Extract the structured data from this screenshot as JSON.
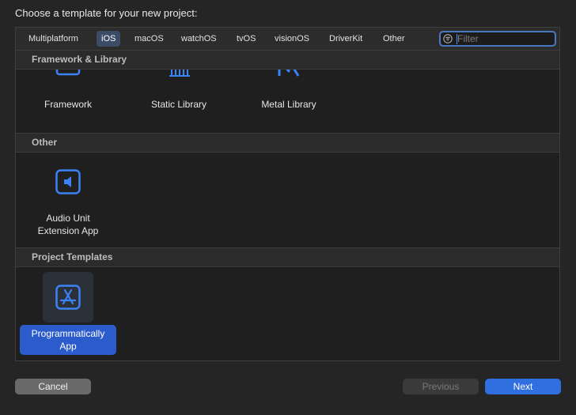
{
  "dialog": {
    "title": "Choose a template for your new project:"
  },
  "tabs": [
    {
      "label": "Multiplatform"
    },
    {
      "label": "iOS",
      "selected": true
    },
    {
      "label": "macOS"
    },
    {
      "label": "watchOS"
    },
    {
      "label": "tvOS"
    },
    {
      "label": "visionOS"
    },
    {
      "label": "DriverKit"
    },
    {
      "label": "Other"
    }
  ],
  "filter": {
    "placeholder": "Filter",
    "value": ""
  },
  "sections": {
    "framework": {
      "title": "Framework & Library",
      "items": [
        {
          "label": "Framework",
          "icon": "framework-icon"
        },
        {
          "label": "Static Library",
          "icon": "static-library-icon"
        },
        {
          "label": "Metal Library",
          "icon": "metal-library-icon"
        }
      ]
    },
    "other": {
      "title": "Other",
      "items": [
        {
          "label_line1": "Audio Unit",
          "label_line2": "Extension App",
          "icon": "audio-unit-icon"
        }
      ]
    },
    "project_templates": {
      "title": "Project Templates",
      "items": [
        {
          "label_line1": "Programmatically",
          "label_line2": "App",
          "icon": "app-store-icon",
          "selected": true
        }
      ]
    }
  },
  "buttons": {
    "cancel": "Cancel",
    "previous": "Previous",
    "next": "Next"
  },
  "colors": {
    "accent": "#2f6fdf",
    "selection": "#2c5ccc",
    "icon_blue": "#3b82f6",
    "background": "#252525"
  }
}
